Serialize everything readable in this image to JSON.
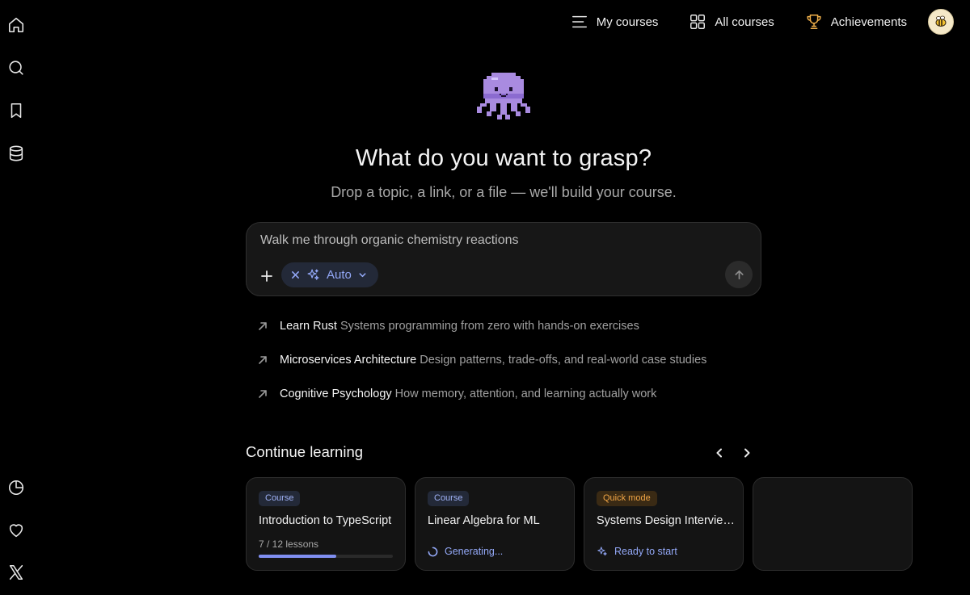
{
  "nav": {
    "my_courses": "My courses",
    "all_courses": "All courses",
    "achievements": "Achievements"
  },
  "hero": {
    "title": "What do you want to grasp?",
    "subtitle": "Drop a topic, a link, or a file — we'll build your course."
  },
  "prompt": {
    "placeholder": "Walk me through organic chemistry reactions",
    "value": "",
    "mode_label": "Auto"
  },
  "suggestions": [
    {
      "title": "Learn Rust",
      "description": "Systems programming from zero with hands-on exercises"
    },
    {
      "title": "Microservices Architecture",
      "description": "Design patterns, trade-offs, and real-world case studies"
    },
    {
      "title": "Cognitive Psychology",
      "description": "How memory, attention, and learning actually work"
    }
  ],
  "continue_learning": {
    "title": "Continue learning",
    "cards": [
      {
        "badge": "Course",
        "title": "Introduction to TypeScript",
        "lessons": "7 / 12 lessons",
        "progress_fraction": 0.58
      },
      {
        "badge": "Course",
        "title": "Linear Algebra for ML",
        "status": "Generating..."
      },
      {
        "badge": "Quick mode",
        "title": "Systems Design Interview Prep",
        "status": "Ready to start"
      }
    ]
  },
  "colors": {
    "background": "#000000",
    "accent": "#93a8f7",
    "quick_mode": "#f0a545",
    "trophy": "#f0b04a",
    "mascot": "#a98be0"
  },
  "icons": {
    "rail": [
      "home-icon",
      "search-icon",
      "bookmark-icon",
      "database-icon",
      "pie-chart-icon",
      "heart-icon",
      "x-logo-icon"
    ],
    "mascot": "octopus-mascot"
  }
}
